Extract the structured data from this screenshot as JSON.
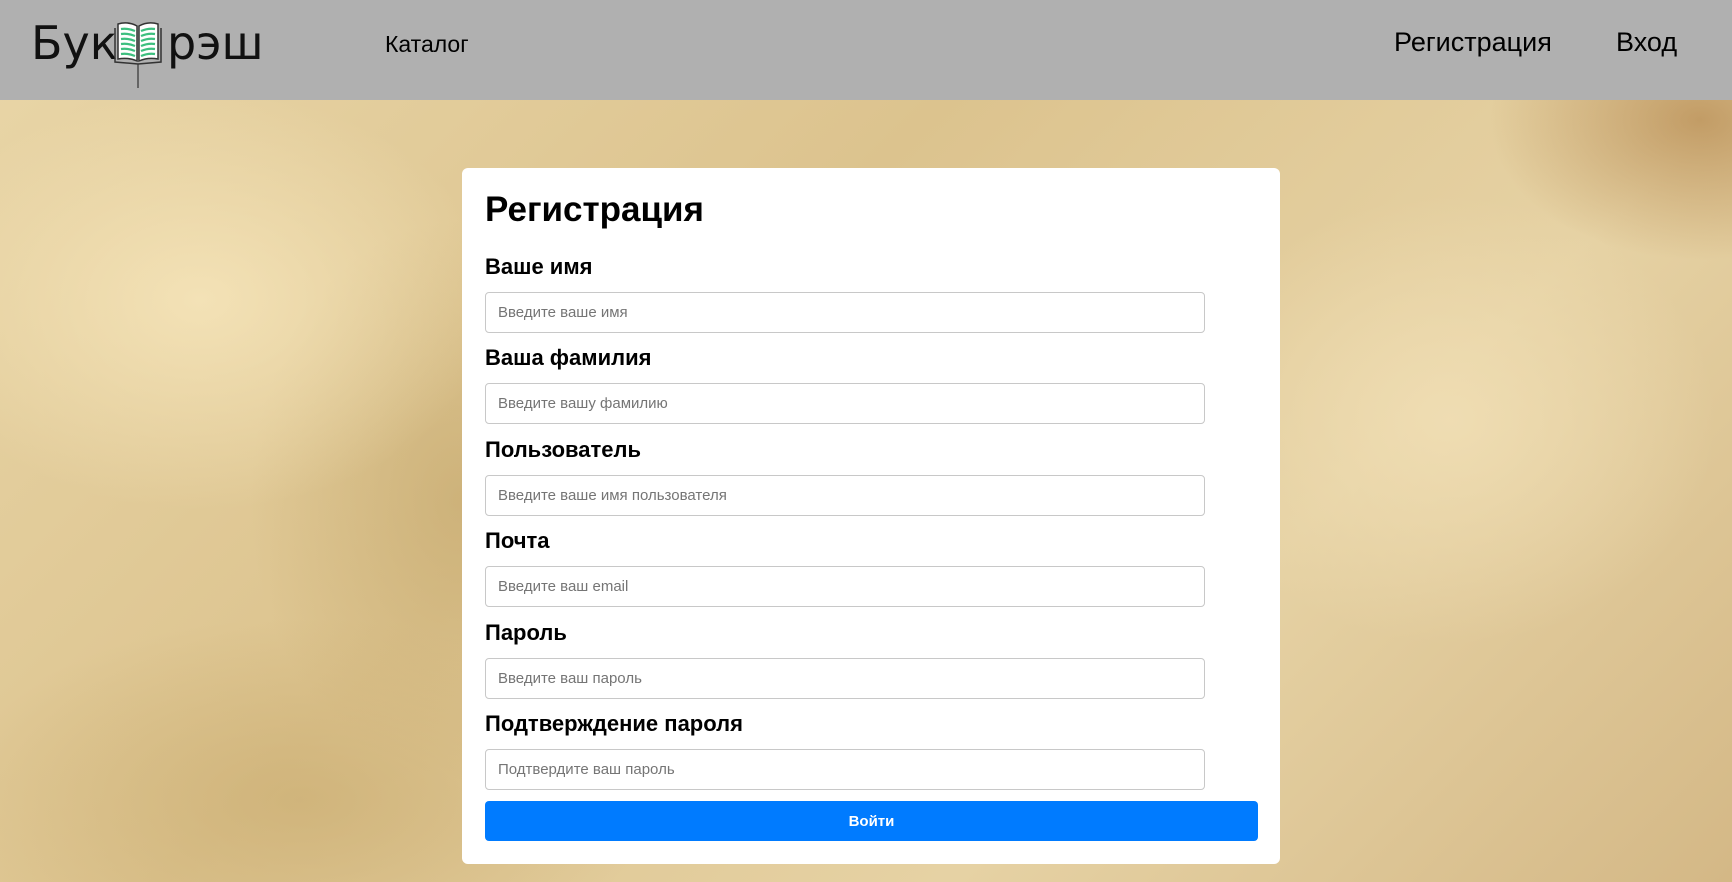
{
  "header": {
    "logo": {
      "left": "Бук",
      "right": "рэш",
      "accent": "#3dbf7f"
    },
    "nav_catalog": "Каталог",
    "nav_register": "Регистрация",
    "nav_login": "Вход"
  },
  "form": {
    "title": "Регистрация",
    "fields": [
      {
        "label": "Ваше имя",
        "placeholder": "Введите ваше имя",
        "value": ""
      },
      {
        "label": "Ваша фамилия",
        "placeholder": "Введите вашу фамилию",
        "value": ""
      },
      {
        "label": "Пользователь",
        "placeholder": "Введите ваше имя пользователя",
        "value": ""
      },
      {
        "label": "Почта",
        "placeholder": "Введите ваш email",
        "value": ""
      },
      {
        "label": "Пароль",
        "placeholder": "Введите ваш пароль",
        "value": ""
      },
      {
        "label": "Подтверждение пароля",
        "placeholder": "Подтвердите ваш пароль",
        "value": ""
      }
    ],
    "submit_label": "Войти",
    "submit_color": "#007bff"
  }
}
